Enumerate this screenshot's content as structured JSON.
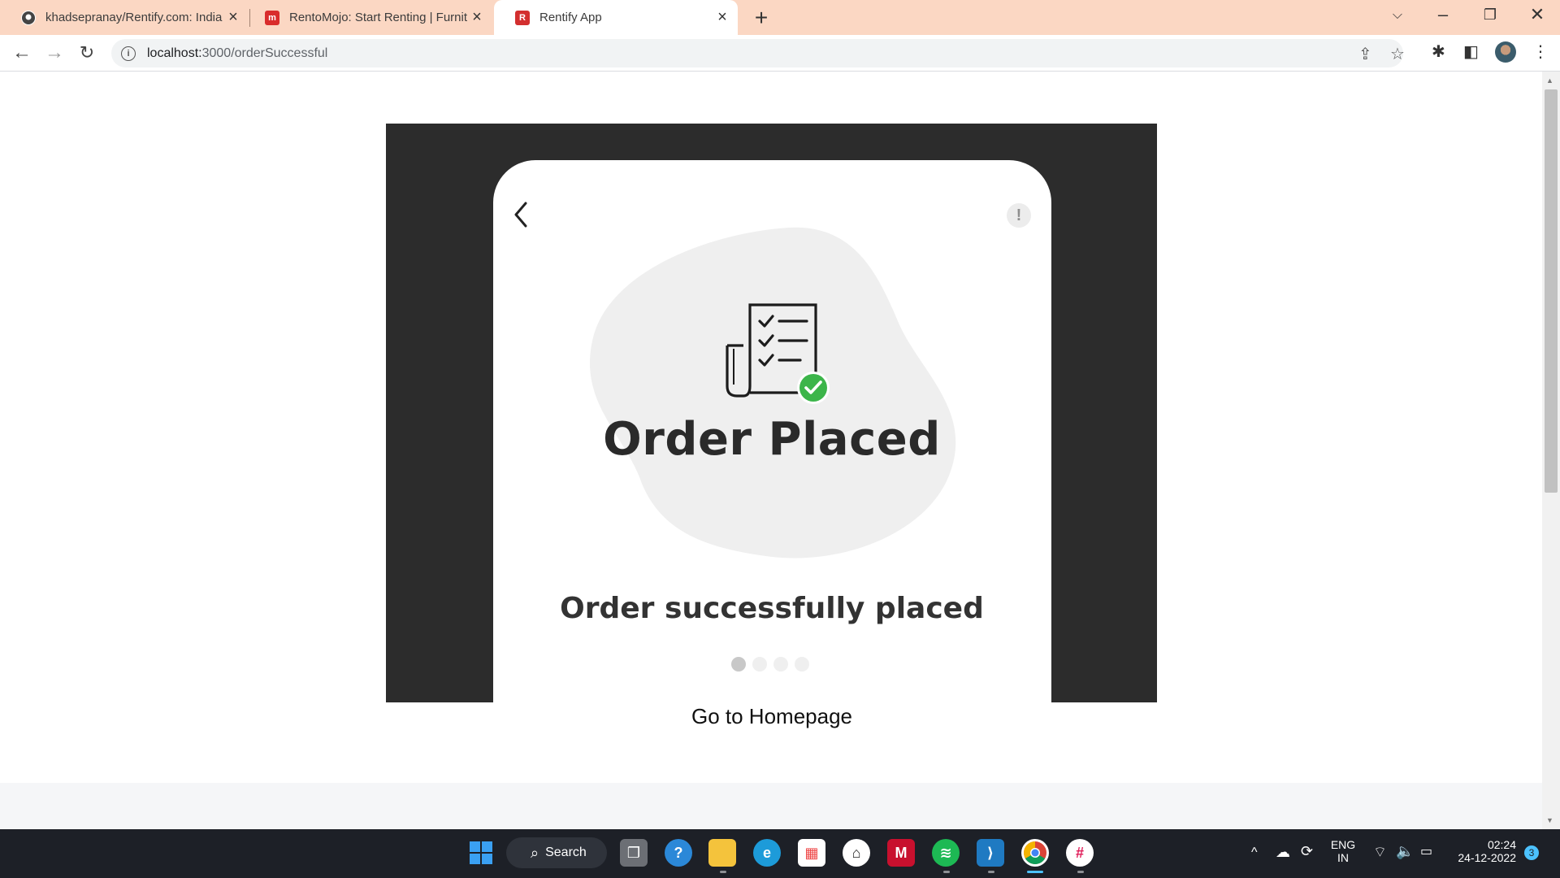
{
  "browser": {
    "tabs": [
      {
        "title": "khadsepranay/Rentify.com: India",
        "favicon": "github-icon",
        "active": false
      },
      {
        "title": "RentoMojo: Start Renting | Furnit",
        "favicon": "rentomojo-icon",
        "active": false
      },
      {
        "title": "Rentify App",
        "favicon": "rentify-icon",
        "active": true
      }
    ],
    "url_host": "localhost:",
    "url_rest": "3000/orderSuccessful"
  },
  "app": {
    "headline": "Order Placed",
    "subline": "Order successfully placed",
    "alert_glyph": "!",
    "carousel_total": 4,
    "carousel_active": 1,
    "home_link": "Go to Homepage",
    "colors": {
      "stage": "#2c2c2c",
      "blob": "#efefef",
      "check": "#3cb54a"
    }
  },
  "taskbar": {
    "search_label": "Search",
    "language": "ENG",
    "region": "IN",
    "time": "02:24",
    "date": "24-12-2022",
    "notification_count": "3"
  }
}
